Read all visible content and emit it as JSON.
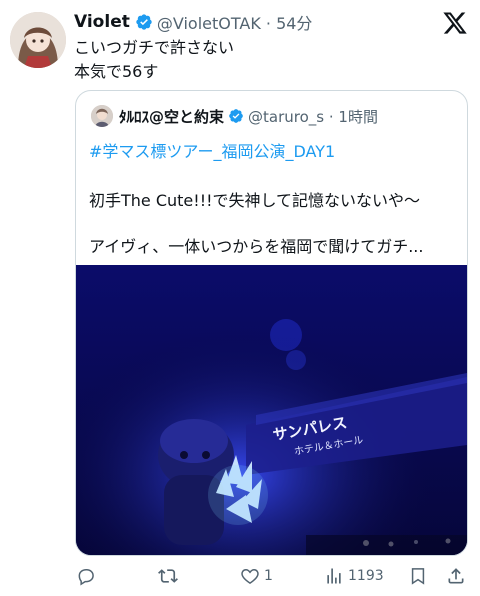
{
  "author": {
    "display_name": "Violet",
    "handle_time": "@VioletOTAK · 54分"
  },
  "tweet": {
    "line1": "こいつガチで許さない",
    "line2": "本気で56す"
  },
  "quote": {
    "display_name": "ﾀﾙﾛｽ@空と約束",
    "handle_time": "@taruro_s · 1時間",
    "hashtag": "#学マス標ツアー_福岡公演_DAY1",
    "line1": "初手The Cute!!!で失神して記憶ないないや〜",
    "line2": "アイヴィ、一体いつからを福岡で聞けてガチ..."
  },
  "photo_sign": {
    "line1": "サンパレス",
    "line2": "ホテル＆ホール"
  },
  "actions": {
    "reply_count": "",
    "retweet_count": "",
    "like_count": "1",
    "views_count": "1193"
  },
  "colors": {
    "link": "#1d9bf0",
    "secondary": "#536471",
    "verified": "#1d9bf0"
  },
  "icons": [
    "verified-icon",
    "x-logo-icon",
    "reply-icon",
    "retweet-icon",
    "like-icon",
    "views-icon",
    "bookmark-icon",
    "share-icon"
  ]
}
